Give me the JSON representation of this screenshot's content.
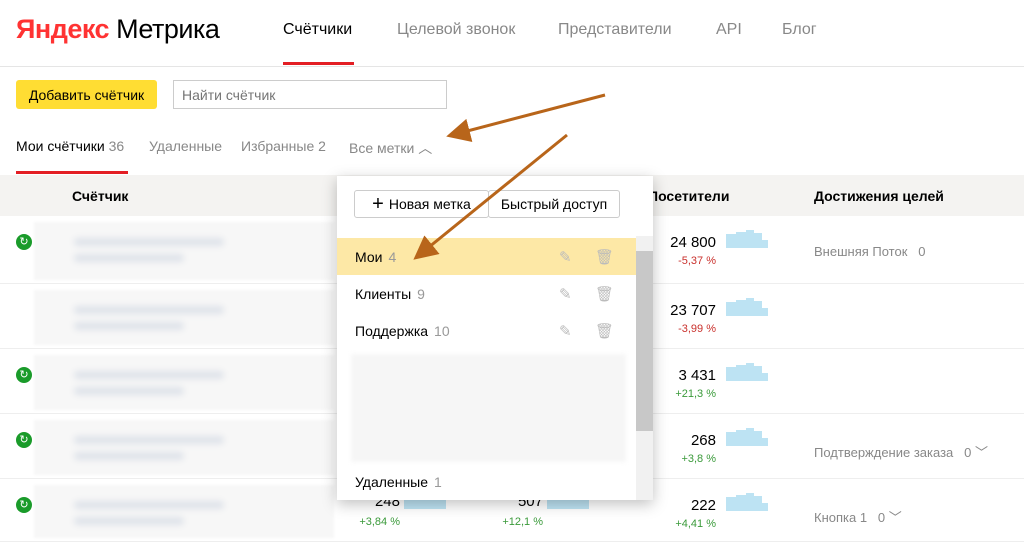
{
  "header": {
    "logo_brand": "Яндекс",
    "logo_product": "Метрика",
    "nav": [
      "Счётчики",
      "Целевой звонок",
      "Представители",
      "API",
      "Блог"
    ]
  },
  "toolbar": {
    "add_label": "Добавить счётчик",
    "search_placeholder": "Найти счётчик"
  },
  "tabs": [
    {
      "label": "Мои счётчики",
      "count": "36"
    },
    {
      "label": "Удаленные",
      "count": ""
    },
    {
      "label": "Избранные",
      "count": "2"
    },
    {
      "label": "Все метки",
      "count": ""
    }
  ],
  "table": {
    "headers": [
      "Счётчик",
      "Посетители",
      "Достижения целей"
    ],
    "rows": [
      {
        "visitors": "24 800",
        "change": "-5,37 %",
        "goal": "Внешняя Поток",
        "goal_count": "0"
      },
      {
        "visitors": "23 707",
        "change": "-3,99 %",
        "goal": "",
        "goal_count": ""
      },
      {
        "visitors": "3 431",
        "change": "+21,3 %",
        "goal": "",
        "goal_count": ""
      },
      {
        "visitors": "268",
        "change": "+3,8 %",
        "goal": "Подтверждение заказа",
        "goal_count": "0"
      },
      {
        "visitors": "222",
        "change": "+4,41 %",
        "goal": "Кнопка 1",
        "goal_count": "0",
        "extra": [
          {
            "value": "248",
            "change": "+3,84 %"
          },
          {
            "value": "507",
            "change": "+12,1 %"
          }
        ]
      }
    ]
  },
  "dropdown": {
    "new_label": "Новая метка",
    "quick_label": "Быстрый доступ",
    "items": [
      {
        "label": "Мои",
        "count": "4"
      },
      {
        "label": "Клиенты",
        "count": "9"
      },
      {
        "label": "Поддержка",
        "count": "10"
      }
    ],
    "deleted": {
      "label": "Удаленные",
      "count": "1"
    }
  },
  "colors": {
    "accent": "#ffdd33",
    "underline": "#e31e24",
    "arrow": "#b8651a",
    "highlight": "#fde8a6"
  }
}
